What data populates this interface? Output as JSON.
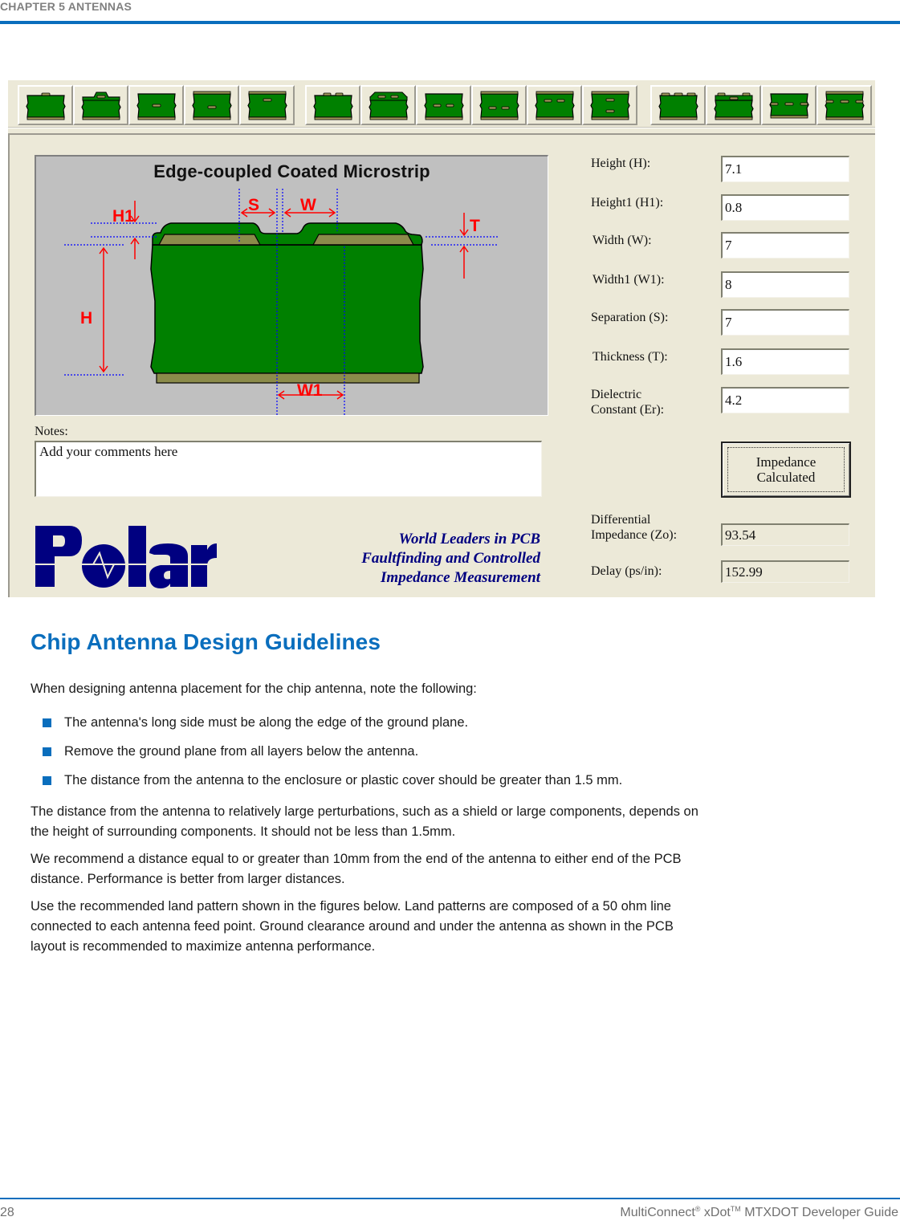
{
  "page": {
    "chapter_header": "CHAPTER 5 ANTENNAS",
    "accent_color": "#0a6ebd"
  },
  "app": {
    "toolbar": {
      "groups": [
        {
          "name": "single-ended",
          "buttons": [
            "Surface Microstrip",
            "Coated Microstrip",
            "Offset Stripline",
            "Symmetric Stripline",
            "Embedded Microstrip"
          ]
        },
        {
          "name": "edge-coupled",
          "buttons": [
            "Edge-coupled Surface Microstrip",
            "Edge-coupled Coated Microstrip",
            "Edge-coupled Embedded Microstrip",
            "Edge-coupled Symmetric Stripline",
            "Edge-coupled Offset Stripline",
            "Broadside-coupled Stripline"
          ]
        },
        {
          "name": "coplanar",
          "buttons": [
            "Coplanar Surface Microstrip",
            "Coplanar Coated Microstrip",
            "Coplanar Embedded",
            "Coplanar Stripline"
          ]
        }
      ]
    },
    "diagram": {
      "title": "Edge-coupled Coated Microstrip",
      "labels": {
        "H1": "H1",
        "S": "S",
        "W": "W",
        "T": "T",
        "H": "H",
        "W1": "W1"
      },
      "colors": {
        "substrate": "#008000",
        "copper": "#8b8b4a",
        "dimension": "#ff0000",
        "guide": "#0000ff"
      }
    },
    "fields": [
      {
        "label": "Height (H):",
        "value": "7.1"
      },
      {
        "label": "Height1  (H1):",
        "value": "0.8"
      },
      {
        "label": "Width (W):",
        "value": "7"
      },
      {
        "label": "Width1  (W1):",
        "value": "8"
      },
      {
        "label": "Separation (S):",
        "value": "7"
      },
      {
        "label": "Thickness (T):",
        "value": "1.6"
      },
      {
        "label_line1": "Dielectric",
        "label_line2": "Constant (Er):",
        "value": "4.2"
      }
    ],
    "calc_button": {
      "line1": "Impedance",
      "line2": "Calculated"
    },
    "results": [
      {
        "label_line1": "Differential",
        "label_line2": "Impedance (Zo):",
        "value": "93.54"
      },
      {
        "label": "Delay (ps/in):",
        "value": "152.99"
      }
    ],
    "notes": {
      "label": "Notes:",
      "value": "Add your comments here"
    },
    "logo": {
      "text": "Polar",
      "color": "#000080"
    },
    "tagline": [
      "World Leaders in PCB",
      "Faultfinding and Controlled",
      "Impedance Measurement"
    ]
  },
  "content": {
    "section_title": "Chip Antenna Design Guidelines",
    "intro": "When designing antenna placement for the chip antenna, note the following:",
    "bullets": [
      "The antenna's long side must be along the edge of the ground plane.",
      "Remove the ground plane from all layers below the antenna.",
      "The distance from the antenna to the enclosure or plastic cover should be greater than 1.5 mm."
    ],
    "paragraphs": [
      {
        "line1": "The distance from the antenna to relatively large perturbations, such as a shield or large components, depends on",
        "line2": "the height of surrounding components. It should not be less than 1.5mm."
      },
      {
        "line1": "We recommend a distance equal to or greater than 10mm from the end of the antenna to either end of the PCB",
        "line2": "distance. Performance is better from larger distances."
      },
      {
        "line1": "Use the recommended land pattern shown in the figures below. Land patterns are composed of a 50 ohm line",
        "line2": "connected to each antenna feed point. Ground clearance around and under the antenna as shown in the PCB",
        "line3": "layout is recommended to maximize antenna performance."
      }
    ]
  },
  "footer": {
    "page_number": "28",
    "product": "MultiConnect",
    "reg": "®",
    "product2": " xDot",
    "tm": "TM",
    "title_rest": " MTXDOT Developer Guide"
  }
}
